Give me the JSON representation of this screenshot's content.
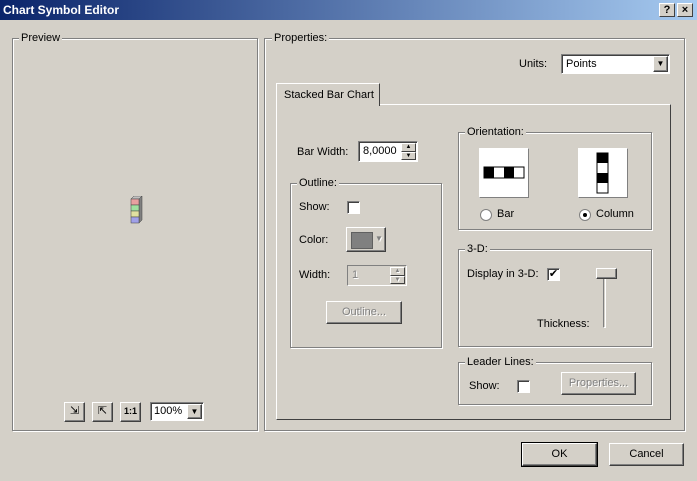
{
  "window": {
    "title": "Chart Symbol Editor",
    "help_btn": "?",
    "close_btn": "×"
  },
  "preview": {
    "label": "Preview",
    "zoom_value": "100%",
    "tools": [
      "zoom-in",
      "zoom-out",
      "actual-size"
    ],
    "tool_glyphs": {
      "zoom_in": "⇲",
      "zoom_out": "⇱",
      "actual": "1:1"
    }
  },
  "properties": {
    "label": "Properties:",
    "units_label": "Units:",
    "units_value": "Points",
    "tab": "Stacked Bar Chart",
    "bar_width_label": "Bar Width:",
    "bar_width_value": "8,0000",
    "outline": {
      "label": "Outline:",
      "show_label": "Show:",
      "show_checked": false,
      "color_label": "Color:",
      "color_value": "#808080",
      "width_label": "Width:",
      "width_value": "1",
      "button": "Outline..."
    },
    "orientation": {
      "label": "Orientation:",
      "bar_label": "Bar",
      "column_label": "Column",
      "selected": "Column"
    },
    "three_d": {
      "label": "3-D:",
      "display_label": "Display in 3-D:",
      "display_checked": true,
      "thickness_label": "Thickness:"
    },
    "leader_lines": {
      "label": "Leader Lines:",
      "show_label": "Show:",
      "show_checked": false,
      "button": "Properties..."
    }
  },
  "buttons": {
    "ok": "OK",
    "cancel": "Cancel"
  },
  "check_glyph": "✔"
}
